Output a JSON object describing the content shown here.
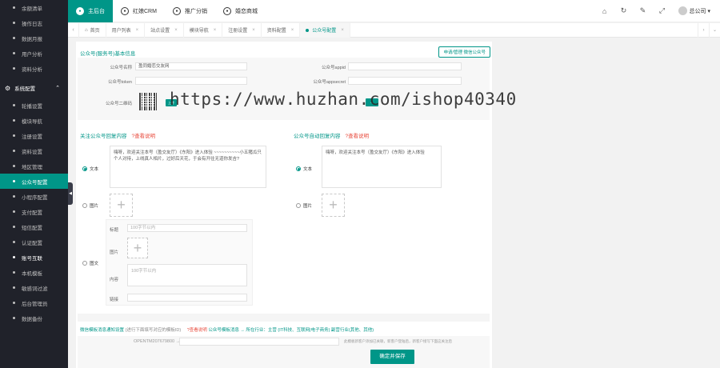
{
  "sidebar": {
    "items": [
      {
        "label": "余额清单",
        "type": "sub"
      },
      {
        "label": "操作日志",
        "type": "sub"
      },
      {
        "label": "数据月报",
        "type": "sub"
      },
      {
        "label": "用户分析",
        "type": "sub"
      },
      {
        "label": "资料分析",
        "type": "sub"
      }
    ],
    "section": "系统配置",
    "section_items": [
      {
        "label": "轮播设置"
      },
      {
        "label": "模块导航"
      },
      {
        "label": "注册设置"
      },
      {
        "label": "资料设置"
      },
      {
        "label": "地区管理"
      },
      {
        "label": "公众号配置",
        "active": true
      },
      {
        "label": "小程序配置"
      },
      {
        "label": "支付配置"
      },
      {
        "label": "短信配置"
      },
      {
        "label": "认证配置"
      },
      {
        "label": "账号互联",
        "bright": true
      },
      {
        "label": "本机模板"
      },
      {
        "label": "敏感词过滤"
      },
      {
        "label": "后台管理员"
      },
      {
        "label": "数据备份"
      }
    ]
  },
  "topbar": {
    "items": [
      {
        "label": "主后台",
        "active": true
      },
      {
        "label": "红娘CRM"
      },
      {
        "label": "推广分销"
      },
      {
        "label": "婚恋商城"
      }
    ],
    "icons": [
      "home-icon",
      "refresh-icon",
      "paint-icon",
      "fullscreen-icon"
    ],
    "user": "总公司"
  },
  "tabs": {
    "items": [
      {
        "label": "首页"
      },
      {
        "label": "用户列表"
      },
      {
        "label": "站点设置"
      },
      {
        "label": "模块导航"
      },
      {
        "label": "注册设置"
      },
      {
        "label": "资料配置"
      },
      {
        "label": "公众号配置",
        "active": true
      }
    ]
  },
  "form": {
    "section1_title": "公众号(服务号)基本信息",
    "apply_btn": "申请/管理 微信公众号",
    "name_label": "公众号名称",
    "name_value": "盈同婚恋交友网",
    "appid_label": "公众号appid",
    "token_label": "公众号token",
    "secret_label": "公众号appsecret",
    "qr_label": "公众号二维码",
    "upload_small": "上传",
    "teal_small": "...",
    "follow_title": "关注公众号回复内容",
    "auto_title": "公众号自动回复内容",
    "help_label": "?查看说明",
    "text_label": "文本",
    "image_label": "图片",
    "article_label": "图文",
    "follow_text": "嗨呀，欢迎关注本号（盈交友厅）《东阳》进入体验 ~~~~~~~~~~小五猪瓜只个人对待，上线真人相片，过好后天花，于会有开往无道你发吉?",
    "auto_text": "嗨呀，欢迎关注本号（盈交友厅）《东阳》进入体验",
    "art_title_label": "标题",
    "art_title_placeholder": "100字节以内",
    "art_image_label": "图片",
    "art_content_label": "内容",
    "art_content_placeholder": "100字节以内",
    "art_link_label": "链接",
    "notice_title": "微信模板消息通知设置",
    "notice_hint": "(进行下面填写对应的模板ID)",
    "notice_path": "公众号模板消息 → 所在行业：主营 (IT科技、互联网|电子商务) 副营行业(其他、其他)",
    "template_code": "OPENTM207679800 →",
    "template_note": "此模板新客户添加已关联，新客户登陆后，新客户接写下面这关注后",
    "save_label": "确定并保存"
  },
  "watermark": "https://www.huzhan.com/ishop40340"
}
